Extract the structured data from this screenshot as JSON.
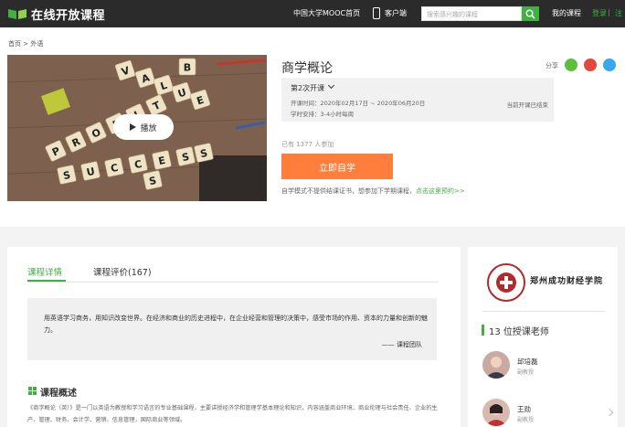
{
  "header": {
    "logo_text": "在线开放课程",
    "nav": [
      "中国大学MOOC首页",
      "客户端"
    ],
    "search_placeholder": "搜索感兴趣的课程",
    "my_courses": "我的课程",
    "login": "登录",
    "register": "注"
  },
  "breadcrumb": "首页 > 外语",
  "cover": {
    "play_label": "播放",
    "tiles": [
      "V",
      "A",
      "L",
      "U",
      "E",
      "B",
      "P",
      "R",
      "O",
      "F",
      "I",
      "T",
      "S",
      "U",
      "C",
      "C",
      "E",
      "S",
      "S",
      "S"
    ]
  },
  "course": {
    "title": "商学概论",
    "share_label": "分享",
    "session_name": "第2次开课",
    "time_line": "开课时间：2020年02月17日 ~ 2020年06月20日",
    "load_line": "学时安排：3-4小时每周",
    "status": "当前开课已结束",
    "enroll_count": "已有 1377 人参加",
    "join_button": "立即自学",
    "note_prefix": "自学模式不提供结课证书，想参加下学期课程，",
    "note_link": "点击这里预约>>"
  },
  "tabs": [
    "课程详情",
    "课程评价(167)"
  ],
  "quote": {
    "text": "用英语学习商务，用知识改变世界。在经济和商业的历史进程中，在企业经营和管理的决策中，感受市场的作用、资本的力量和创新的魅力。",
    "signature": "—— 课程团队"
  },
  "overview": {
    "title": "课程概述",
    "text": "《商学概论（英）》是一门以英语为教授和学习语言的专业基础课程，主要讲授经济学和管理学基本理论和知识，内容涵盖商业环境、商业伦理与社会责任、企业的生产、管理、财务、会计学、营销、信息管理，国际商业等领域。"
  },
  "sidebar": {
    "school_name": "郑州成功财经学院",
    "teachers_title": "13 位授课老师",
    "teachers": [
      {
        "name": "邱培磊",
        "title": "副教授"
      },
      {
        "name": "王勋",
        "title": "副教授"
      }
    ]
  },
  "colors": {
    "brand_green": "#40b041",
    "join_orange": "#ff7e3b",
    "nav_bg": "#2b2b2b"
  }
}
